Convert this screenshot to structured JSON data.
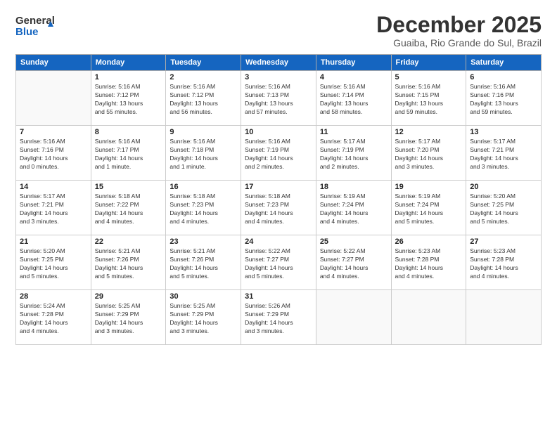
{
  "logo": {
    "line1": "General",
    "line2": "Blue"
  },
  "title": "December 2025",
  "location": "Guaiba, Rio Grande do Sul, Brazil",
  "days_of_week": [
    "Sunday",
    "Monday",
    "Tuesday",
    "Wednesday",
    "Thursday",
    "Friday",
    "Saturday"
  ],
  "weeks": [
    [
      {
        "day": "",
        "info": ""
      },
      {
        "day": "1",
        "info": "Sunrise: 5:16 AM\nSunset: 7:12 PM\nDaylight: 13 hours\nand 55 minutes."
      },
      {
        "day": "2",
        "info": "Sunrise: 5:16 AM\nSunset: 7:12 PM\nDaylight: 13 hours\nand 56 minutes."
      },
      {
        "day": "3",
        "info": "Sunrise: 5:16 AM\nSunset: 7:13 PM\nDaylight: 13 hours\nand 57 minutes."
      },
      {
        "day": "4",
        "info": "Sunrise: 5:16 AM\nSunset: 7:14 PM\nDaylight: 13 hours\nand 58 minutes."
      },
      {
        "day": "5",
        "info": "Sunrise: 5:16 AM\nSunset: 7:15 PM\nDaylight: 13 hours\nand 59 minutes."
      },
      {
        "day": "6",
        "info": "Sunrise: 5:16 AM\nSunset: 7:16 PM\nDaylight: 13 hours\nand 59 minutes."
      }
    ],
    [
      {
        "day": "7",
        "info": "Sunrise: 5:16 AM\nSunset: 7:16 PM\nDaylight: 14 hours\nand 0 minutes."
      },
      {
        "day": "8",
        "info": "Sunrise: 5:16 AM\nSunset: 7:17 PM\nDaylight: 14 hours\nand 1 minute."
      },
      {
        "day": "9",
        "info": "Sunrise: 5:16 AM\nSunset: 7:18 PM\nDaylight: 14 hours\nand 1 minute."
      },
      {
        "day": "10",
        "info": "Sunrise: 5:16 AM\nSunset: 7:19 PM\nDaylight: 14 hours\nand 2 minutes."
      },
      {
        "day": "11",
        "info": "Sunrise: 5:17 AM\nSunset: 7:19 PM\nDaylight: 14 hours\nand 2 minutes."
      },
      {
        "day": "12",
        "info": "Sunrise: 5:17 AM\nSunset: 7:20 PM\nDaylight: 14 hours\nand 3 minutes."
      },
      {
        "day": "13",
        "info": "Sunrise: 5:17 AM\nSunset: 7:21 PM\nDaylight: 14 hours\nand 3 minutes."
      }
    ],
    [
      {
        "day": "14",
        "info": "Sunrise: 5:17 AM\nSunset: 7:21 PM\nDaylight: 14 hours\nand 3 minutes."
      },
      {
        "day": "15",
        "info": "Sunrise: 5:18 AM\nSunset: 7:22 PM\nDaylight: 14 hours\nand 4 minutes."
      },
      {
        "day": "16",
        "info": "Sunrise: 5:18 AM\nSunset: 7:23 PM\nDaylight: 14 hours\nand 4 minutes."
      },
      {
        "day": "17",
        "info": "Sunrise: 5:18 AM\nSunset: 7:23 PM\nDaylight: 14 hours\nand 4 minutes."
      },
      {
        "day": "18",
        "info": "Sunrise: 5:19 AM\nSunset: 7:24 PM\nDaylight: 14 hours\nand 4 minutes."
      },
      {
        "day": "19",
        "info": "Sunrise: 5:19 AM\nSunset: 7:24 PM\nDaylight: 14 hours\nand 5 minutes."
      },
      {
        "day": "20",
        "info": "Sunrise: 5:20 AM\nSunset: 7:25 PM\nDaylight: 14 hours\nand 5 minutes."
      }
    ],
    [
      {
        "day": "21",
        "info": "Sunrise: 5:20 AM\nSunset: 7:25 PM\nDaylight: 14 hours\nand 5 minutes."
      },
      {
        "day": "22",
        "info": "Sunrise: 5:21 AM\nSunset: 7:26 PM\nDaylight: 14 hours\nand 5 minutes."
      },
      {
        "day": "23",
        "info": "Sunrise: 5:21 AM\nSunset: 7:26 PM\nDaylight: 14 hours\nand 5 minutes."
      },
      {
        "day": "24",
        "info": "Sunrise: 5:22 AM\nSunset: 7:27 PM\nDaylight: 14 hours\nand 5 minutes."
      },
      {
        "day": "25",
        "info": "Sunrise: 5:22 AM\nSunset: 7:27 PM\nDaylight: 14 hours\nand 4 minutes."
      },
      {
        "day": "26",
        "info": "Sunrise: 5:23 AM\nSunset: 7:28 PM\nDaylight: 14 hours\nand 4 minutes."
      },
      {
        "day": "27",
        "info": "Sunrise: 5:23 AM\nSunset: 7:28 PM\nDaylight: 14 hours\nand 4 minutes."
      }
    ],
    [
      {
        "day": "28",
        "info": "Sunrise: 5:24 AM\nSunset: 7:28 PM\nDaylight: 14 hours\nand 4 minutes."
      },
      {
        "day": "29",
        "info": "Sunrise: 5:25 AM\nSunset: 7:29 PM\nDaylight: 14 hours\nand 3 minutes."
      },
      {
        "day": "30",
        "info": "Sunrise: 5:25 AM\nSunset: 7:29 PM\nDaylight: 14 hours\nand 3 minutes."
      },
      {
        "day": "31",
        "info": "Sunrise: 5:26 AM\nSunset: 7:29 PM\nDaylight: 14 hours\nand 3 minutes."
      },
      {
        "day": "",
        "info": ""
      },
      {
        "day": "",
        "info": ""
      },
      {
        "day": "",
        "info": ""
      }
    ]
  ]
}
